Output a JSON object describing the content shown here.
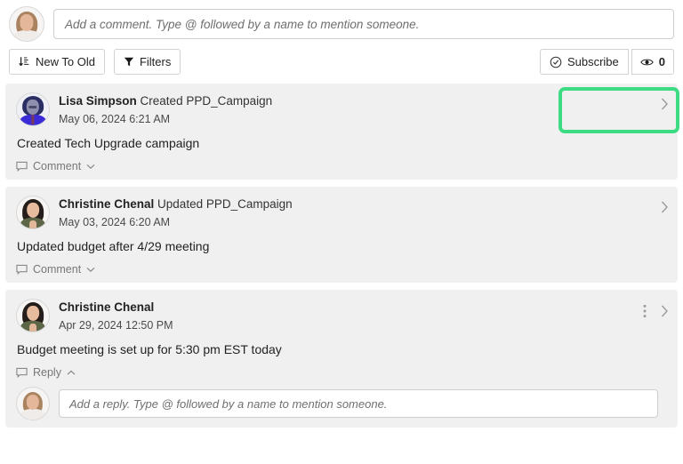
{
  "composer": {
    "avatar": "user-avatar-blonde",
    "placeholder": "Add a comment. Type @ followed by a name to mention someone."
  },
  "toolbar": {
    "sort_label": "New To Old",
    "sort_icon": "sort-descending-icon",
    "filters_label": "Filters",
    "filters_icon": "funnel-icon",
    "subscribe_label": "Subscribe",
    "subscribe_icon": "check-circle-icon",
    "views_count": "0",
    "views_icon": "eye-icon",
    "highlight_color": "#3ddc84"
  },
  "feed": {
    "entries": [
      {
        "avatar": "avatar-illustration",
        "author": "Lisa Simpson",
        "action": "Created PPD_Campaign",
        "timestamp": "May 06, 2024 6:21 AM",
        "body": "Created Tech Upgrade campaign",
        "action_label": "Comment",
        "action_icon": "comment-bubble-icon",
        "chevron": "chevron-down-icon",
        "has_kebab": false,
        "expanded": false
      },
      {
        "avatar": "avatar-brunette",
        "author": "Christine Chenal",
        "action": "Updated PPD_Campaign",
        "timestamp": "May 03, 2024 6:20 AM",
        "body": "Updated budget after 4/29 meeting",
        "action_label": "Comment",
        "action_icon": "comment-bubble-icon",
        "chevron": "chevron-down-icon",
        "has_kebab": false,
        "expanded": false
      },
      {
        "avatar": "avatar-brunette",
        "author": "Christine Chenal",
        "action": "",
        "timestamp": "Apr 29, 2024 12:50 PM",
        "body": "Budget meeting is set up for 5:30 pm EST today",
        "action_label": "Reply",
        "action_icon": "comment-bubble-icon",
        "chevron": "chevron-up-icon",
        "has_kebab": true,
        "expanded": true,
        "reply_placeholder": "Add a reply. Type @ followed by a name to mention someone."
      }
    ]
  }
}
